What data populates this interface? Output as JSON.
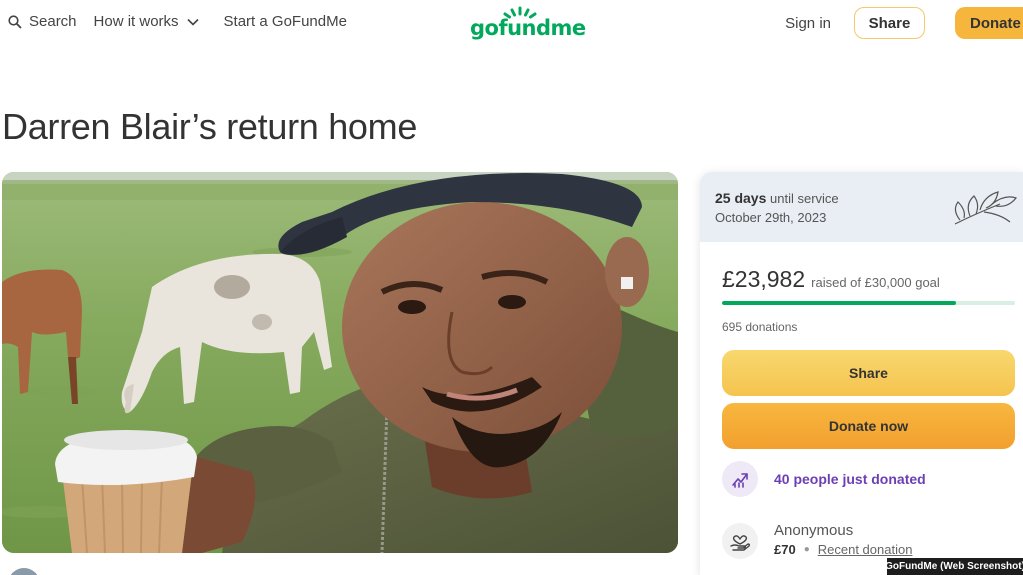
{
  "header": {
    "search_label": "Search",
    "how_label": "How it works",
    "start_label": "Start a GoFundMe",
    "logo_text": "gofundme",
    "signin_label": "Sign in",
    "share_label": "Share",
    "donate_label": "Donate"
  },
  "campaign": {
    "title": "Darren Blair’s return home"
  },
  "service": {
    "days": "25 days",
    "until": "until service",
    "date": "October 29th, 2023"
  },
  "funding": {
    "raised": "£23,982",
    "goal_text": "raised of £30,000 goal",
    "progress_fraction": 0.7994,
    "donations_count": "695 donations"
  },
  "buttons": {
    "share": "Share",
    "donate_now": "Donate now"
  },
  "activity": {
    "text": "40 people just donated"
  },
  "recent_donor": {
    "name": "Anonymous",
    "amount": "£70",
    "label": "Recent donation"
  },
  "watermark": "GoFundMe (Web Screenshot)",
  "colors": {
    "brand_green": "#02a95c",
    "donate_orange": "#f2a02f",
    "share_yellow": "#f5c34f",
    "activity_purple": "#6c3fb3"
  },
  "icons": [
    "search-icon",
    "chevron-down-icon",
    "sun-icon",
    "flower-icon",
    "trending-up-icon",
    "heart-hand-icon"
  ]
}
